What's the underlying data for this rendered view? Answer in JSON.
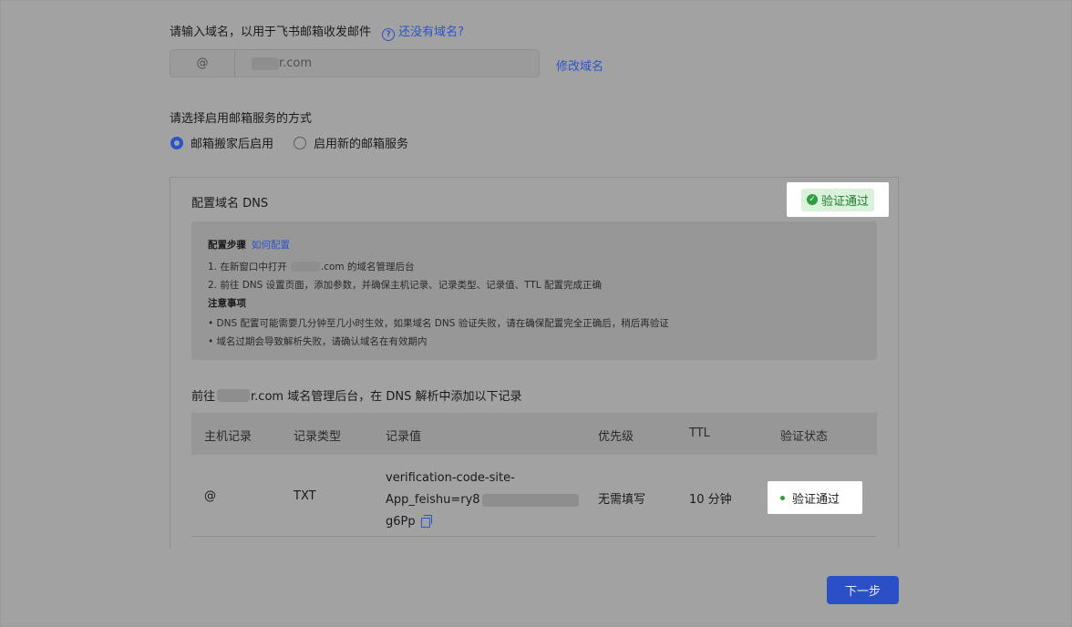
{
  "domain_section": {
    "prompt": "请输入域名，以用于飞书邮箱收发邮件",
    "help_link": "还没有域名?",
    "at_symbol": "@",
    "domain_suffix": "r.com",
    "modify_link": "修改域名"
  },
  "mode_section": {
    "title": "请选择启用邮箱服务的方式",
    "options": [
      {
        "label": "邮箱搬家后启用",
        "selected": true
      },
      {
        "label": "启用新的邮箱服务",
        "selected": false
      }
    ]
  },
  "dns_card": {
    "title": "配置域名 DNS",
    "status_badge": "验证通过",
    "steps": {
      "heading": "配置步骤",
      "how_link": "如何配置",
      "step1_prefix": "1. 在新窗口中打开",
      "step1_suffix": ".com 的域名管理后台",
      "step2": "2. 前往 DNS 设置页面，添加参数，并确保主机记录、记录类型、记录值、TTL 配置完成正确",
      "notes_heading": "注意事项",
      "note1": "• DNS 配置可能需要几分钟至几小时生效，如果域名 DNS 验证失败，请在确保配置完全正确后，稍后再验证",
      "note2": "• 域名过期会导致解析失败，请确认域名在有效期内"
    },
    "goto_prefix": "前往",
    "goto_suffix": "r.com 域名管理后台，在 DNS 解析中添加以下记录",
    "table": {
      "headers": [
        "主机记录",
        "记录类型",
        "记录值",
        "优先级",
        "TTL",
        "验证状态"
      ],
      "row": {
        "host": "@",
        "type": "TXT",
        "value_line1": "verification-code-site-",
        "value_line2": "App_feishu=ry8",
        "value_line3": "g6Pp",
        "priority": "无需填写",
        "ttl": "10 分钟",
        "status": "验证通过"
      }
    }
  },
  "footer": {
    "next_button": "下一步"
  },
  "colors": {
    "accent": "#2b54c9",
    "success": "#2e9c3f",
    "overlay_bg": "#a2a2a2"
  }
}
